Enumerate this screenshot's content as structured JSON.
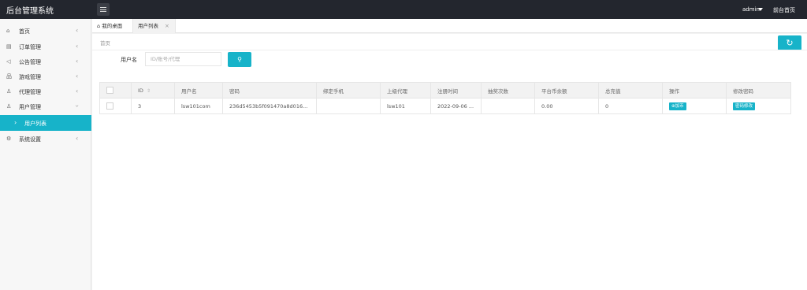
{
  "header": {
    "app_title": "后台管理系统",
    "user": "admin",
    "front_link": "前台首页"
  },
  "sidebar": {
    "items": [
      {
        "label": "首页",
        "icon": "home-icon"
      },
      {
        "label": "订单管理",
        "icon": "order-icon"
      },
      {
        "label": "公告管理",
        "icon": "speaker-icon"
      },
      {
        "label": "游戏管理",
        "icon": "sitemap-icon"
      },
      {
        "label": "代理管理",
        "icon": "user-icon"
      },
      {
        "label": "用户管理",
        "icon": "user-icon"
      },
      {
        "label": "用户列表",
        "icon": "chevron-right-icon"
      },
      {
        "label": "系统设置",
        "icon": "gear-icon"
      }
    ]
  },
  "tabs": {
    "home": "我的桌面",
    "active": "用户列表"
  },
  "breadcrumb": "首页",
  "filter": {
    "label": "用户名",
    "placeholder": "ID/账号/代理"
  },
  "table": {
    "columns": [
      "",
      "ID",
      "用户名",
      "密码",
      "绑定手机",
      "上级代理",
      "注册时间",
      "抽奖次数",
      "平台币余额",
      "总充值",
      "操作",
      "修改密码"
    ],
    "rows": [
      {
        "id": "3",
        "username": "lsw101com",
        "password": "236d5453b5f091470a8d016...",
        "phone": "",
        "agent": "lsw101",
        "reg_time": "2022-09-06 ...",
        "lottery": "",
        "balance": "0.00",
        "total_recharge": "0",
        "action_label": "加币",
        "modify_label": "密码修改"
      }
    ]
  },
  "colors": {
    "accent": "#17b3c9",
    "topbar": "#23262e"
  }
}
